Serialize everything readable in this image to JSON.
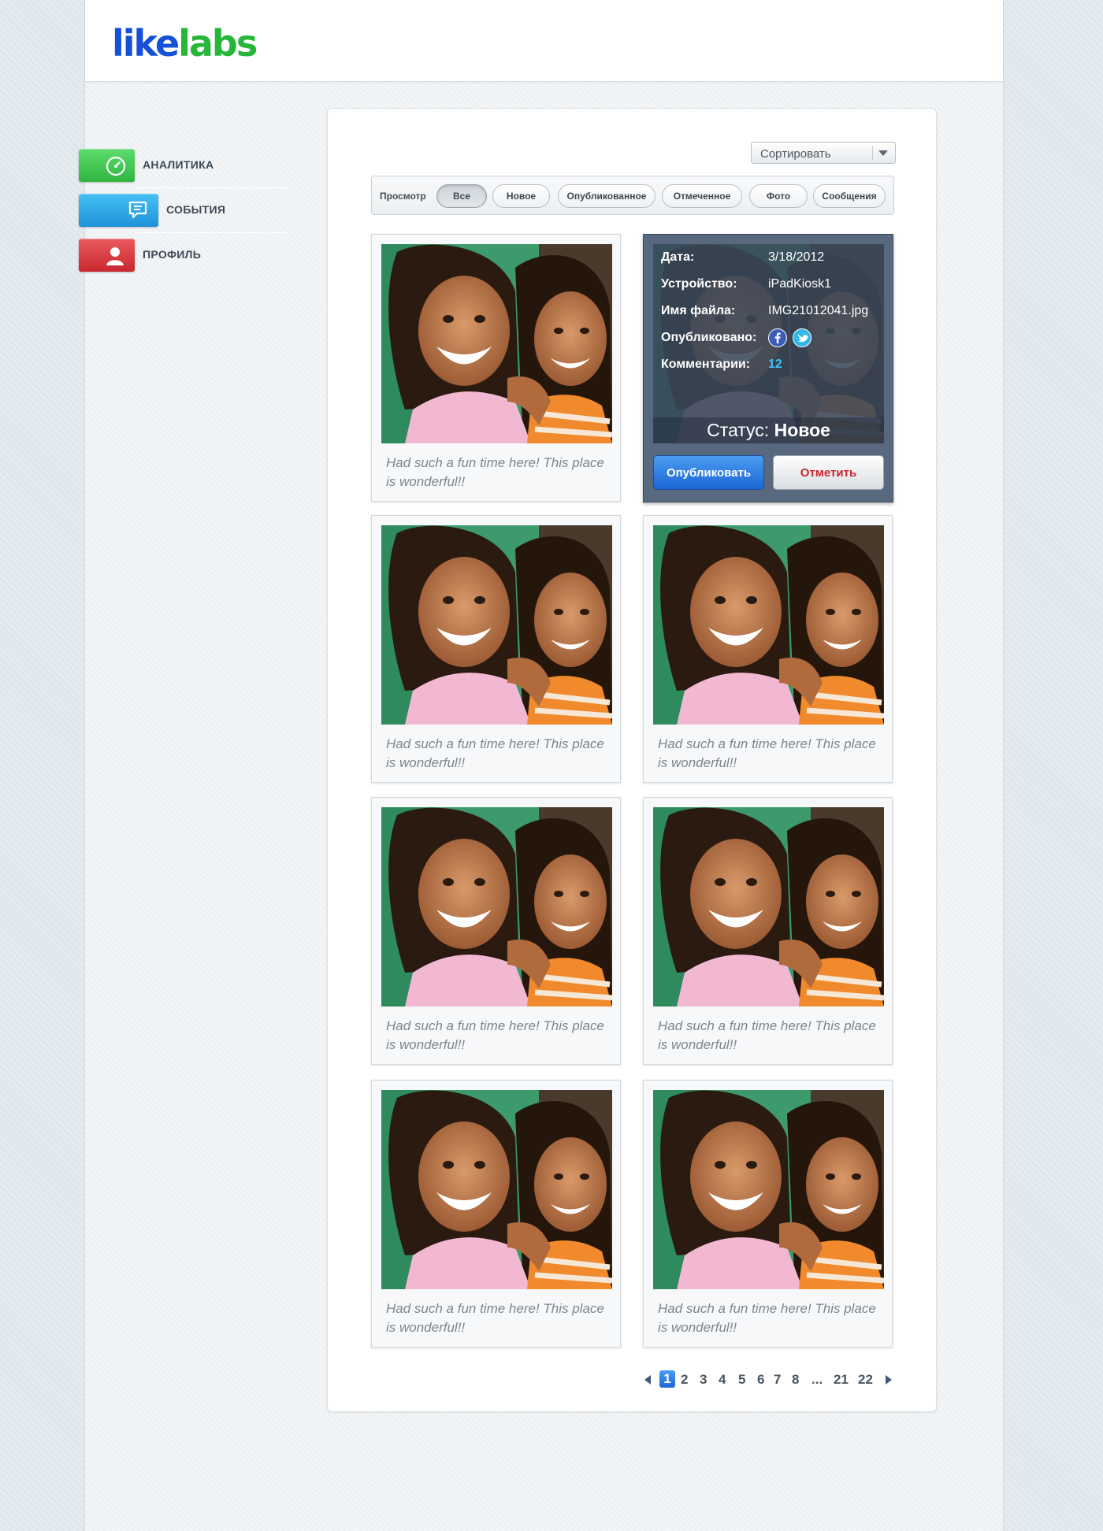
{
  "logo": {
    "part1": "like",
    "part2": "labs"
  },
  "nav": {
    "items": [
      {
        "label": "АНАЛИТИКА",
        "icon": "speedometer-icon",
        "color": "#3ec74f"
      },
      {
        "label": "СОБЫТИЯ",
        "icon": "chat-bubble-icon",
        "color": "#2aa6e6"
      },
      {
        "label": "ПРОФИЛЬ",
        "icon": "user-icon",
        "color": "#d9393d"
      }
    ]
  },
  "sort": {
    "label": "Сортировать"
  },
  "filters": {
    "label": "Просмотр",
    "items": [
      "Все",
      "Новое",
      "Опубликованное",
      "Отмеченное",
      "Фото",
      "Сообщения"
    ],
    "active": "Все"
  },
  "caption": "Had such a fun time here! This place is wonderful!!",
  "detail": {
    "date_label": "Дата:",
    "date_value": "3/18/2012",
    "device_label": "Устройство:",
    "device_value": "iPadKiosk1",
    "file_label": "Имя файла:",
    "file_value": "IMG21012041.jpg",
    "published_label": "Опубликовано:",
    "comments_label": "Комментарии:",
    "comments_value": "12",
    "status_label": "Статус:",
    "status_value": "Новое",
    "publish_button": "Опубликовать",
    "mark_button": "Отметить"
  },
  "pagination": {
    "pages": [
      "1",
      "2",
      "3",
      "4",
      "5",
      "6",
      "7",
      "8",
      "...",
      "21",
      "22"
    ],
    "current": "1"
  }
}
